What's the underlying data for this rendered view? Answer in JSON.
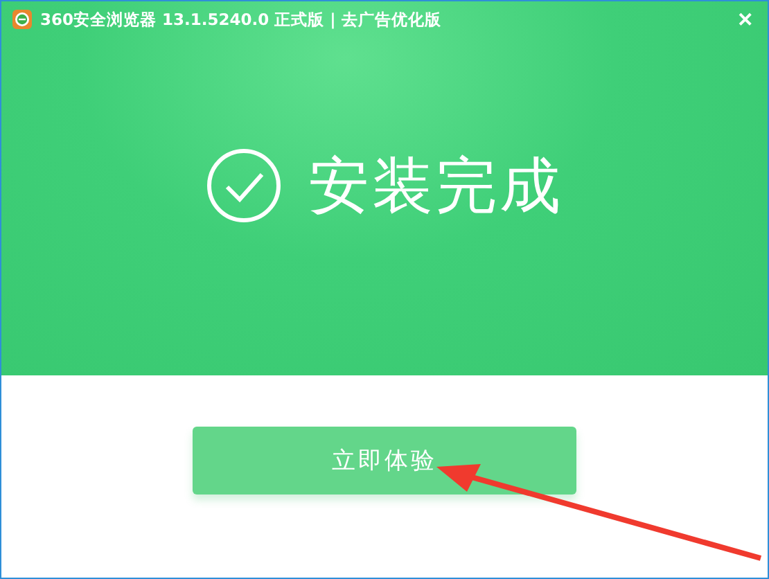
{
  "window": {
    "title": "360安全浏览器 13.1.5240.0 正式版 | 去广告优化版",
    "close": "✕"
  },
  "banner": {
    "message": "安装完成"
  },
  "action": {
    "label": "立即体验"
  }
}
